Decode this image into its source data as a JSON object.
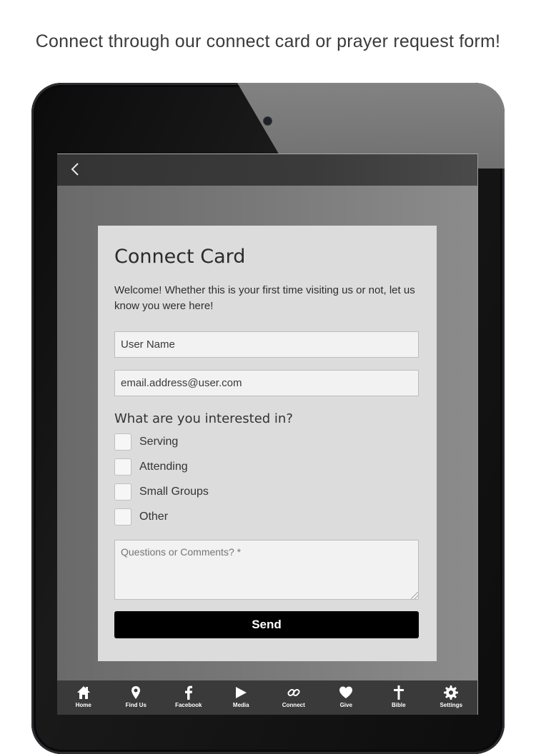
{
  "headline": "Connect through our connect card or prayer request form!",
  "topbar": {
    "back_icon": "chevron-left-icon"
  },
  "card": {
    "title": "Connect Card",
    "intro": "Welcome! Whether this is your first time visiting us or not, let us know you were here!",
    "name_value": "User Name",
    "email_value": "email.address@user.com",
    "question": "What are you interested in?",
    "options": [
      "Serving",
      "Attending",
      "Small Groups",
      "Other"
    ],
    "comments_placeholder": "Questions or Comments? *",
    "send_label": "Send"
  },
  "tabbar": {
    "items": [
      {
        "label": "Home",
        "icon": "home-icon"
      },
      {
        "label": "Find Us",
        "icon": "map-pin-icon"
      },
      {
        "label": "Facebook",
        "icon": "facebook-icon"
      },
      {
        "label": "Media",
        "icon": "play-icon"
      },
      {
        "label": "Connect",
        "icon": "link-icon"
      },
      {
        "label": "Give",
        "icon": "heart-icon"
      },
      {
        "label": "Bible",
        "icon": "cross-icon"
      },
      {
        "label": "Settings",
        "icon": "gear-icon"
      }
    ]
  },
  "colors": {
    "card_bg": "#dcdcdc",
    "send_bg": "#000000",
    "tabbar_bg": "#3a3a3a",
    "topbar_bg": "#343434"
  }
}
